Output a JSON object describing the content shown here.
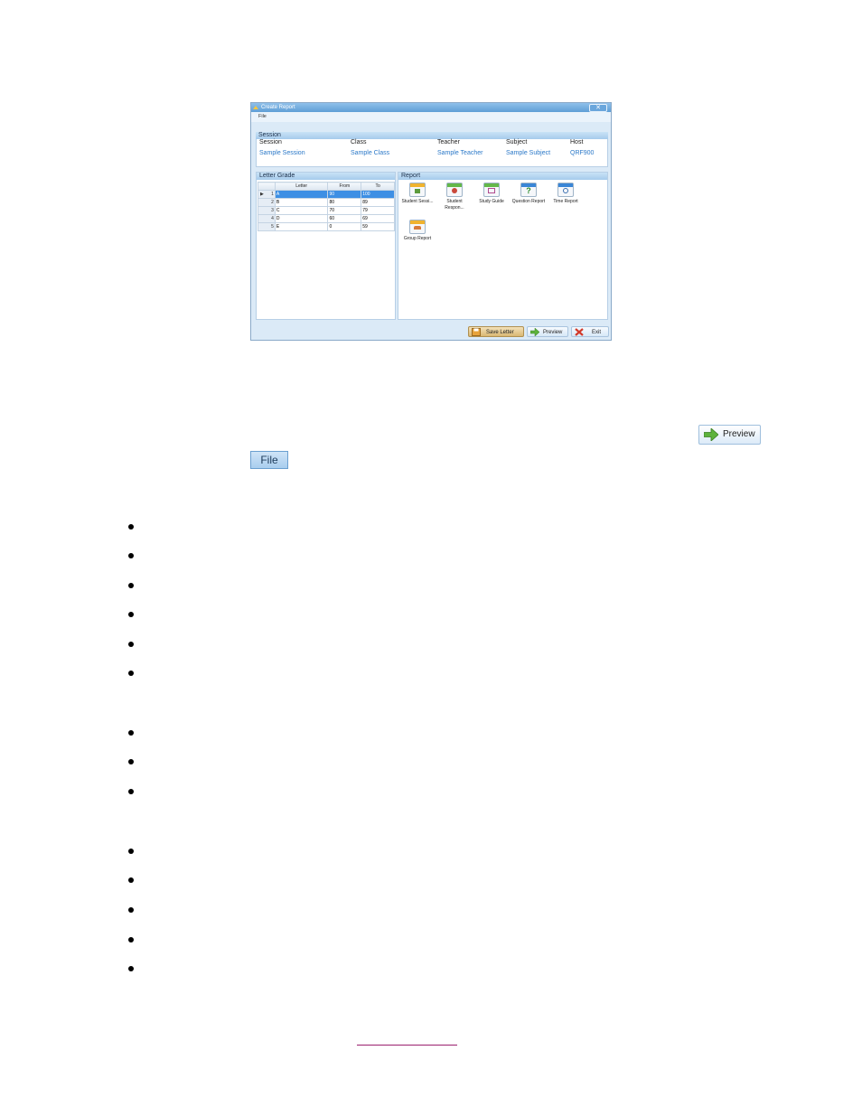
{
  "window": {
    "title": "Create Report",
    "close_glyph": "✕",
    "menu": [
      "File"
    ]
  },
  "session": {
    "heading": "Session",
    "columns": [
      {
        "label": "Session",
        "value": "Sample Session"
      },
      {
        "label": "Class",
        "value": "Sample Class"
      },
      {
        "label": "Teacher",
        "value": "Sample Teacher"
      },
      {
        "label": "Subject",
        "value": "Sample Subject"
      },
      {
        "label": "Host",
        "value": "QRF900"
      }
    ]
  },
  "letter_grade": {
    "heading": "Letter Grade",
    "headers": [
      "Letter",
      "From",
      "To"
    ],
    "rows": [
      {
        "num": "1",
        "letter": "A",
        "from": "90",
        "to": "100",
        "selected": true
      },
      {
        "num": "2",
        "letter": "B",
        "from": "80",
        "to": "89",
        "selected": false
      },
      {
        "num": "3",
        "letter": "C",
        "from": "70",
        "to": "79",
        "selected": false
      },
      {
        "num": "4",
        "letter": "D",
        "from": "60",
        "to": "69",
        "selected": false
      },
      {
        "num": "5",
        "letter": "E",
        "from": "0",
        "to": "59",
        "selected": false
      }
    ]
  },
  "report": {
    "heading": "Report",
    "items": [
      {
        "label": "Student Sessi...",
        "icon": "student-session-icon",
        "color": "#f0b32e"
      },
      {
        "label": "Student Respon...",
        "icon": "student-response-icon",
        "color": "#64b84a"
      },
      {
        "label": "Study Guide",
        "icon": "study-guide-icon",
        "color": "#64b84a"
      },
      {
        "label": "Question Report",
        "icon": "question-report-icon",
        "color": "#3a86d6"
      },
      {
        "label": "Time Report",
        "icon": "time-report-icon",
        "color": "#3a86d6"
      },
      {
        "label": "Group Report",
        "icon": "group-report-icon",
        "color": "#f0b32e"
      }
    ]
  },
  "buttons": {
    "save_letter": "Save Letter",
    "preview": "Preview",
    "exit": "Exit"
  },
  "inline_buttons": {
    "preview": "Preview",
    "file": "File"
  },
  "colors": {
    "accent": "#2a78c8",
    "selection": "#3d8fe4",
    "link_underline": "#9b1f6e"
  }
}
